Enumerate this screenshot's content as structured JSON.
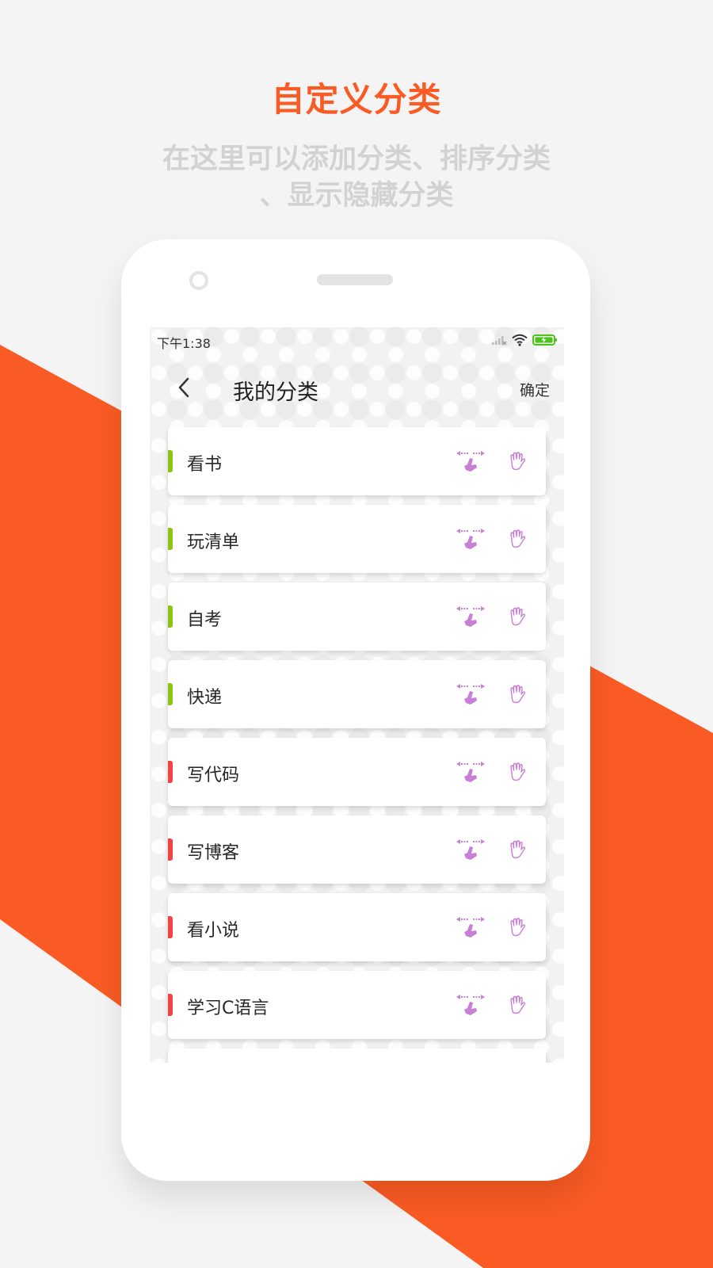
{
  "header": {
    "title": "自定义分类",
    "subtitle_line1": "在这里可以添加分类、排序分类",
    "subtitle_line2": "、显示隐藏分类"
  },
  "statusbar": {
    "time": "下午1:38"
  },
  "appbar": {
    "title": "我的分类",
    "confirm_label": "确定"
  },
  "categories": [
    {
      "label": "看书",
      "color": "#8cc414"
    },
    {
      "label": "玩清单",
      "color": "#8cc414"
    },
    {
      "label": "自考",
      "color": "#8cc414"
    },
    {
      "label": "快递",
      "color": "#8cc414"
    },
    {
      "label": "写代码",
      "color": "#f24445"
    },
    {
      "label": "写博客",
      "color": "#f24445"
    },
    {
      "label": "看小说",
      "color": "#f24445"
    },
    {
      "label": "学习C语言",
      "color": "#f24445"
    }
  ],
  "colors": {
    "accent": "#fa5b24",
    "icon_purple": "#c87fd6",
    "battery_green": "#4cc417"
  },
  "icons": {
    "row_sort": "drag-sort-icon",
    "row_handle": "hand-icon",
    "back": "back-arrow-icon"
  }
}
